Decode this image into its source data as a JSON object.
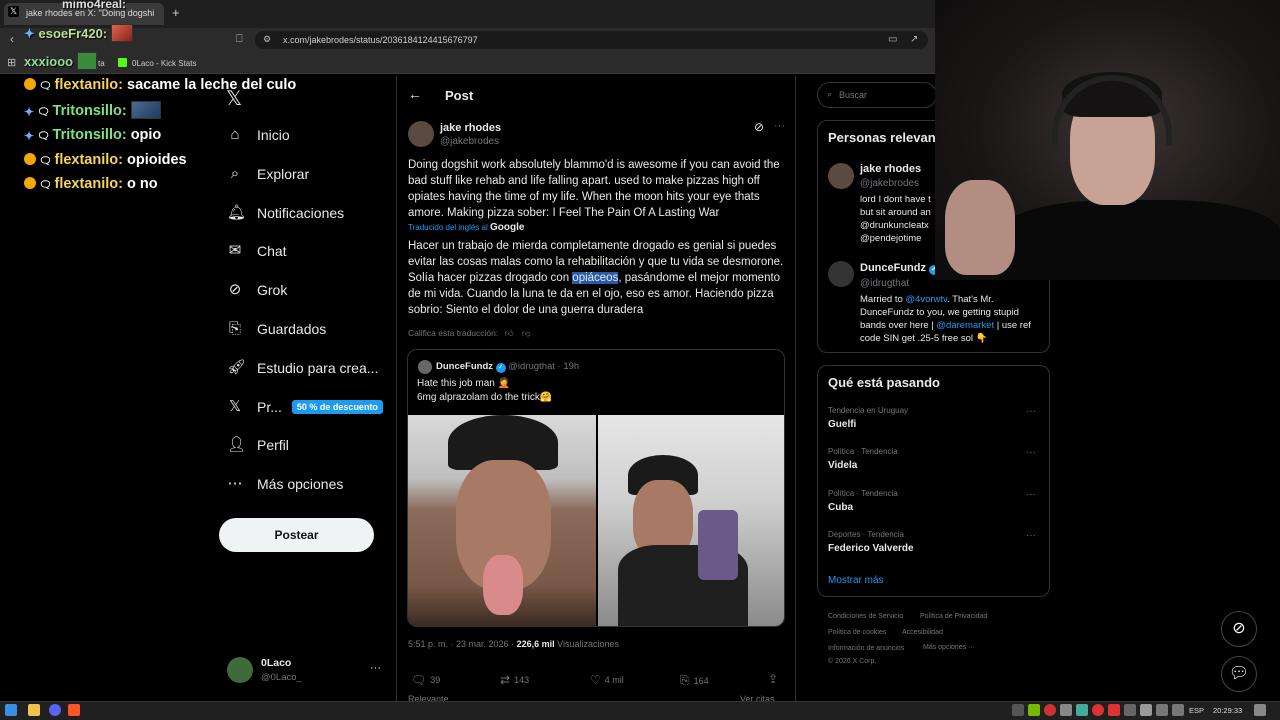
{
  "browser": {
    "tab_title": "jake rhodes en X: \"Doing dogshi",
    "tab_favicon": "x-logo-icon",
    "url": "x.com/jakebrodes/status/2036184124415676797",
    "bookmark_kick": "0Laco - Kick Stats",
    "bookmark_partial": "ta"
  },
  "chat": [
    {
      "badge": "sub",
      "user": "flextanilo",
      "message": "sacame la leche del culo",
      "emote": false
    },
    {
      "badge": "pin",
      "user": "Tritonsillo",
      "message": "",
      "emote": true
    },
    {
      "badge": "pin",
      "user": "Tritonsillo",
      "message": "opio",
      "emote": false
    },
    {
      "badge": "sub",
      "user": "flextanilo",
      "message": "opioides",
      "emote": false
    },
    {
      "badge": "sub",
      "user": "flextanilo",
      "message": "o no",
      "emote": false
    }
  ],
  "chat_top": {
    "user1": "esoeFr420:",
    "user2": "xxxiooo",
    "user3": "mimo4real:"
  },
  "nav": {
    "items": [
      {
        "label": "Inicio",
        "icon": "home-icon"
      },
      {
        "label": "Explorar",
        "icon": "search-icon"
      },
      {
        "label": "Notificaciones",
        "icon": "bell-icon"
      },
      {
        "label": "Chat",
        "icon": "mail-icon"
      },
      {
        "label": "Grok",
        "icon": "grok-icon"
      },
      {
        "label": "Guardados",
        "icon": "bookmark-icon"
      },
      {
        "label": "Estudio para crea...",
        "icon": "rocket-icon"
      },
      {
        "label": "Pr...",
        "icon": "x-logo-icon"
      },
      {
        "label": "Perfil",
        "icon": "person-icon"
      },
      {
        "label": "Más opciones",
        "icon": "more-circle-icon"
      }
    ],
    "premium_badge": "50 % de descuento",
    "post_button": "Postear",
    "account_name": "0Laco",
    "account_handle": "@0Laco_"
  },
  "post": {
    "header": "Post",
    "author_name": "jake rhodes",
    "author_handle": "@jakebrodes",
    "text_original": "Doing dogshit work absolutely blammo'd is awesome if you can avoid the bad stuff like rehab and  life falling apart. used to make pizzas high off opiates having the time of my life. When the moon hits your eye thats amore. Making pizza sober: I Feel The Pain Of A Lasting War",
    "translated_by": "Traducido del inglés al",
    "translated_engine": "Google",
    "text_translated_before": "Hacer un trabajo de mierda completamente drogado es genial si puedes evitar las cosas malas como la rehabilitación y que tu vida se desmorone. Solía hacer pizzas drogado con ",
    "text_translated_highlight": "opiáceos",
    "text_translated_after": ", pasándome el mejor momento de mi vida. Cuando la luna te da en el ojo, eso es amor. Haciendo pizza sobrio: Siento el dolor de una guerra duradera",
    "rate_translation": "Califica esta traducción:",
    "quote": {
      "name": "DunceFundz",
      "handle": "@idrugthat",
      "time": "· 19h",
      "line1": "Hate this job man 🤦",
      "line2": "6mg alprazolam do the trick🤗"
    },
    "timestamp": "5:51 p. m. · 23 mar. 2026 ·",
    "views_count": "226,6 mil",
    "views_label": "Visualizaciones",
    "actions": {
      "replies": "39",
      "reposts": "143",
      "likes": "4 mil",
      "bookmarks": "164"
    },
    "relevant_label": "Relevante",
    "view_quotes": "Ver citas"
  },
  "right": {
    "search_placeholder": "Buscar",
    "people_title": "Personas relevan",
    "person1": {
      "name": "jake rhodes",
      "handle": "@jakebrodes",
      "bio_line1": "lord I dont have t",
      "bio_line2": "but sit around an",
      "bio_link1": "@drunkuncleatx",
      "bio_link2": "@pendejotime"
    },
    "person2": {
      "name": "DunceFundz",
      "handle": "@idrugthat",
      "bio_a": "Married to ",
      "bio_link_a": "@4vorwtv",
      "bio_b": ". That's Mr. DunceFundz to you, we getting stupid bands over here | ",
      "bio_link_b": "@daremarket",
      "bio_c": " | use ref code SIN get .25-5 free sol 👇"
    },
    "trends_title": "Qué está pasando",
    "trends": [
      {
        "meta": "Tendencia en Uruguay",
        "name": "Guelfi"
      },
      {
        "meta": "Política · Tendencia",
        "name": "Videla"
      },
      {
        "meta": "Política · Tendencia",
        "name": "Cuba"
      },
      {
        "meta": "Deportes · Tendencia",
        "name": "Federico Valverde"
      }
    ],
    "show_more": "Mostrar más",
    "footer": {
      "terms": "Condiciones de Servicio",
      "privacy": "Política de Privacidad",
      "cookies": "Política de cookies",
      "accessibility": "Accesibilidad",
      "ads": "Información de anuncios",
      "more": "Más opciones ···",
      "copyright": "© 2026 X Corp."
    }
  },
  "taskbar": {
    "lang": "ESP",
    "time": "20:29:33"
  },
  "colors": {
    "accent": "#1d9bf0",
    "chat_sub_user": "#f6d35a",
    "chat_pin_user": "#7fe07f",
    "highlight": "#2a5ba8"
  }
}
